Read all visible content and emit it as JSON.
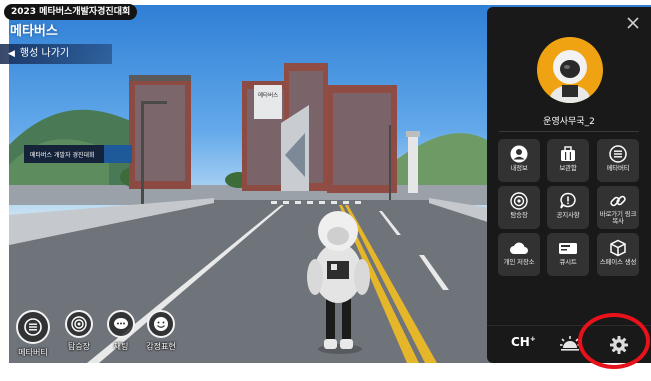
{
  "hud": {
    "event_banner": "2023 메타버스개발자경진대회",
    "world_title": "메타버스",
    "exit_button": "행성 나가기"
  },
  "scene": {
    "billboard_left": "메타버스 개발자 경진대회",
    "billboard_building": "메타버스 개발자 경진대회"
  },
  "quick_buttons": [
    {
      "label": "메타버티",
      "icon": "list-icon"
    },
    {
      "label": "탐승장",
      "icon": "target-icon"
    },
    {
      "label": "채팅",
      "icon": "chat-icon"
    },
    {
      "label": "감정표현",
      "icon": "smile-icon"
    }
  ],
  "panel": {
    "username": "운영사무국_2",
    "tiles": [
      {
        "label": "내정보",
        "icon": "user-icon"
      },
      {
        "label": "보관함",
        "icon": "bag-icon"
      },
      {
        "label": "메타버티",
        "icon": "list-icon"
      },
      {
        "label": "탐승장",
        "icon": "target-icon"
      },
      {
        "label": "공지사항",
        "icon": "notice-icon"
      },
      {
        "label": "바로가기 링크복사",
        "icon": "link-icon"
      },
      {
        "label": "개인 저장소",
        "icon": "cloud-icon"
      },
      {
        "label": "큐시트",
        "icon": "cuesheet-icon"
      },
      {
        "label": "스페이스 생성",
        "icon": "box-icon"
      }
    ],
    "bottom": {
      "channel_label": "CH",
      "channel_sup": "+"
    }
  },
  "colors": {
    "panel_bg": "#191919",
    "tile_bg": "#323232",
    "avatar_bg": "#f0a312",
    "annotation": "#e8121b"
  }
}
